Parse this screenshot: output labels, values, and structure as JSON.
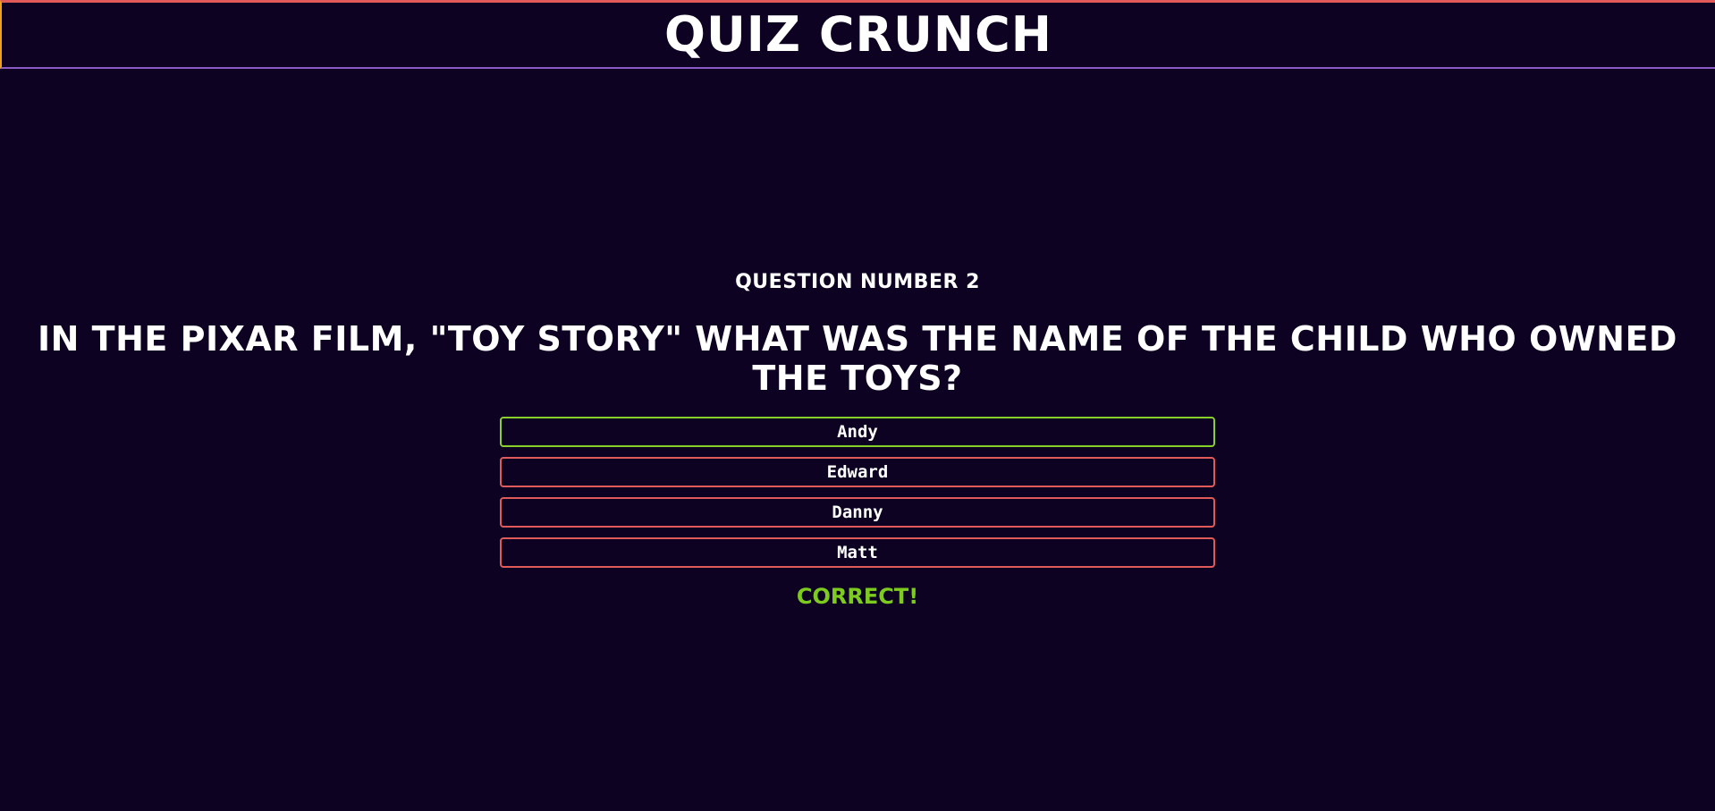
{
  "header": {
    "title": "QUIZ CRUNCH"
  },
  "quiz": {
    "question_number": "QUESTION NUMBER 2",
    "question": "IN THE PIXAR FILM, \"TOY STORY\" WHAT WAS THE NAME OF THE CHILD WHO OWNED THE TOYS?",
    "answers": [
      {
        "label": "Andy",
        "state": "correct"
      },
      {
        "label": "Edward",
        "state": "incorrect"
      },
      {
        "label": "Danny",
        "state": "incorrect"
      },
      {
        "label": "Matt",
        "state": "incorrect"
      }
    ],
    "feedback": "CORRECT!"
  },
  "colors": {
    "background": "#0d0221",
    "correct": "#8ad02c",
    "incorrect": "#e15a5a",
    "feedback": "#7ecb20"
  }
}
